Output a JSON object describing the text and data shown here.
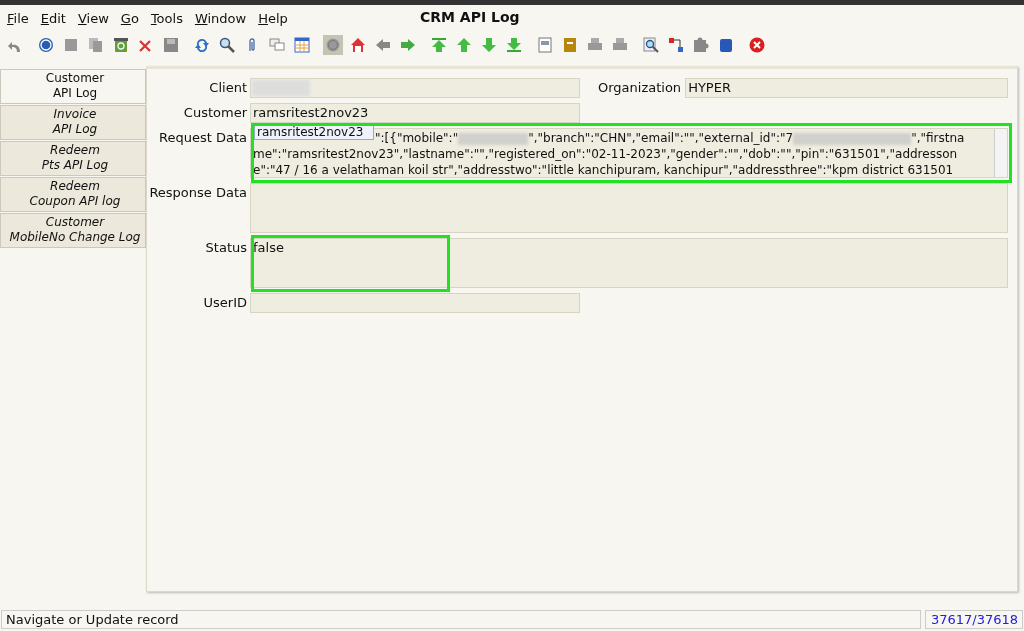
{
  "menu": [
    "File",
    "Edit",
    "View",
    "Go",
    "Tools",
    "Window",
    "Help"
  ],
  "window": {
    "title": "CRM API Log"
  },
  "toolbar": [
    {
      "kind": "undo",
      "pressed": false
    },
    {
      "kind": "help",
      "pressed": false
    },
    {
      "kind": "block",
      "pressed": false
    },
    {
      "kind": "copy",
      "pressed": false
    },
    {
      "kind": "bin",
      "pressed": false
    },
    {
      "kind": "cross",
      "pressed": false
    },
    {
      "kind": "save",
      "pressed": false
    },
    {
      "kind": "refresh",
      "pressed": false
    },
    {
      "kind": "search",
      "pressed": false
    },
    {
      "kind": "clip",
      "pressed": false
    },
    {
      "kind": "chat",
      "pressed": false
    },
    {
      "kind": "grid",
      "pressed": false
    },
    {
      "kind": "circle",
      "pressed": true
    },
    {
      "kind": "home",
      "pressed": false
    },
    {
      "kind": "left",
      "pressed": false
    },
    {
      "kind": "right",
      "pressed": false
    },
    {
      "kind": "first",
      "pressed": false
    },
    {
      "kind": "up",
      "pressed": false
    },
    {
      "kind": "down",
      "pressed": false
    },
    {
      "kind": "last",
      "pressed": false
    },
    {
      "kind": "doc",
      "pressed": false
    },
    {
      "kind": "cabinet",
      "pressed": false
    },
    {
      "kind": "printer",
      "pressed": false
    },
    {
      "kind": "printer",
      "pressed": false
    },
    {
      "kind": "zoomdoc",
      "pressed": false
    },
    {
      "kind": "flow",
      "pressed": false
    },
    {
      "kind": "puzzle",
      "pressed": false
    },
    {
      "kind": "cylinder",
      "pressed": false
    },
    {
      "kind": "close",
      "pressed": false
    }
  ],
  "tabs": [
    {
      "lines": [
        "Customer",
        "API Log"
      ],
      "selected": true
    },
    {
      "lines": [
        "Invoice",
        "API Log"
      ],
      "selected": false
    },
    {
      "lines": [
        "Redeem",
        "Pts API Log"
      ],
      "selected": false
    },
    {
      "lines": [
        "Redeem",
        "Coupon API log"
      ],
      "selected": false
    },
    {
      "lines": [
        "Customer",
        "MobileNo Change Log"
      ],
      "selected": false
    }
  ],
  "form": {
    "client": {
      "label": "Client",
      "blurred": true
    },
    "organization": {
      "label": "Organization",
      "value": "HYPER"
    },
    "customer": {
      "label": "Customer",
      "value": "ramsritest2nov23"
    },
    "request_data": {
      "label": "Request Data",
      "highlighted": true,
      "tooltip": "ramsritest2nov23",
      "lines": [
        [
          {
            "kind": "covered"
          },
          {
            "kind": "text",
            "text": "\":[{\"mobile\":\""
          },
          {
            "kind": "redacted"
          },
          {
            "kind": "text",
            "text": "\",\"branch\":\"CHN\",\"email\":\"\",\"external_id\":\"7"
          },
          {
            "kind": "redacted"
          },
          {
            "kind": "text",
            "text": "\",\"firstna"
          }
        ],
        [
          {
            "kind": "text",
            "text": "me\":\"ramsritest2nov23\",\"lastname\":\"\",\"registered_on\":\"02-11-2023\",\"gender\":\"\",\"dob\":\"\",\"pin\":\"631501\",\"addresson"
          }
        ],
        [
          {
            "kind": "text",
            "text": "e\":\"47 / 16 a velathaman koil str\",\"addresstwo\":\"little kanchipuram, kanchipur\",\"addressthree\":\"kpm district 631501"
          }
        ]
      ]
    },
    "response_data": {
      "label": "Response Data"
    },
    "status": {
      "label": "Status",
      "value": "false",
      "highlighted": true
    },
    "user_id": {
      "label": "UserID"
    }
  },
  "status_bar": {
    "message": "Navigate or Update record",
    "record": "37617/37618"
  }
}
